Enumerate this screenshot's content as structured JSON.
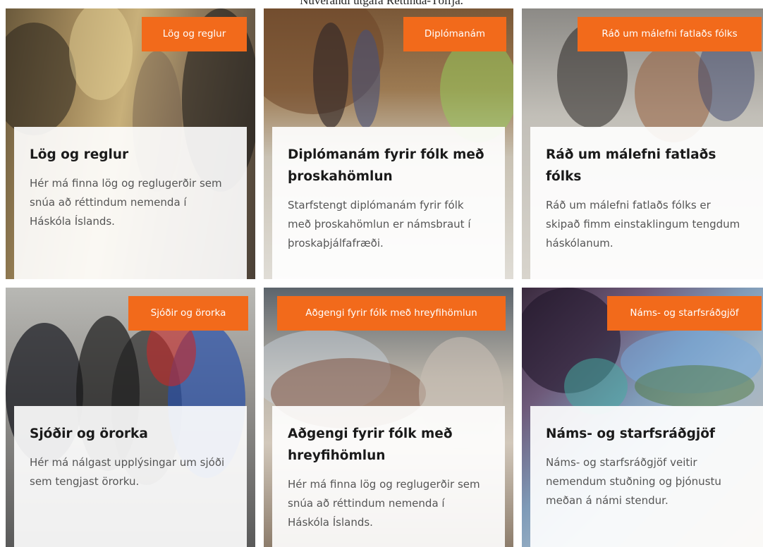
{
  "caption": "Núverandi útgáfa Rettinda-Tölfja.",
  "colors": {
    "badge": "#f26a1b",
    "panel": "#ffffff",
    "title": "#1a1a1a",
    "body": "#555555"
  },
  "cards": [
    {
      "badge": "Lög og reglur",
      "title": "Lög og reglur",
      "description": "Hér má finna lög og reglugerðir sem snúa að réttindum nemenda í Háskóla Íslands."
    },
    {
      "badge": "Diplómanám",
      "title": "Diplómanám fyrir fólk með þroskahömlun",
      "description": "Starfstengt diplómanám fyrir fólk með þroskahömlun er námsbraut í þroskaþjálfafræði."
    },
    {
      "badge": "Ráð um málefni fatlaðs fólks",
      "title": "Ráð um málefni fatlaðs fólks",
      "description": "Ráð um málefni fatlaðs fólks er skipað fimm einstaklingum tengdum háskólanum."
    },
    {
      "badge": "Sjóðir og örorka",
      "title": "Sjóðir og örorka",
      "description": "Hér má nálgast upplýsingar um sjóði sem tengjast örorku."
    },
    {
      "badge": "Aðgengi fyrir fólk með hreyfihömlun",
      "title": "Aðgengi fyrir fólk með hreyfihömlun",
      "description": "Hér má finna lög og reglugerðir sem snúa að réttindum nemenda í Háskóla Íslands."
    },
    {
      "badge": "Náms- og starfsráðgjöf",
      "title": "Náms- og starfsráðgjöf",
      "description": "Náms- og starfsráðgjöf veitir nemendum stuðning og þjónustu meðan á námi stendur."
    }
  ]
}
